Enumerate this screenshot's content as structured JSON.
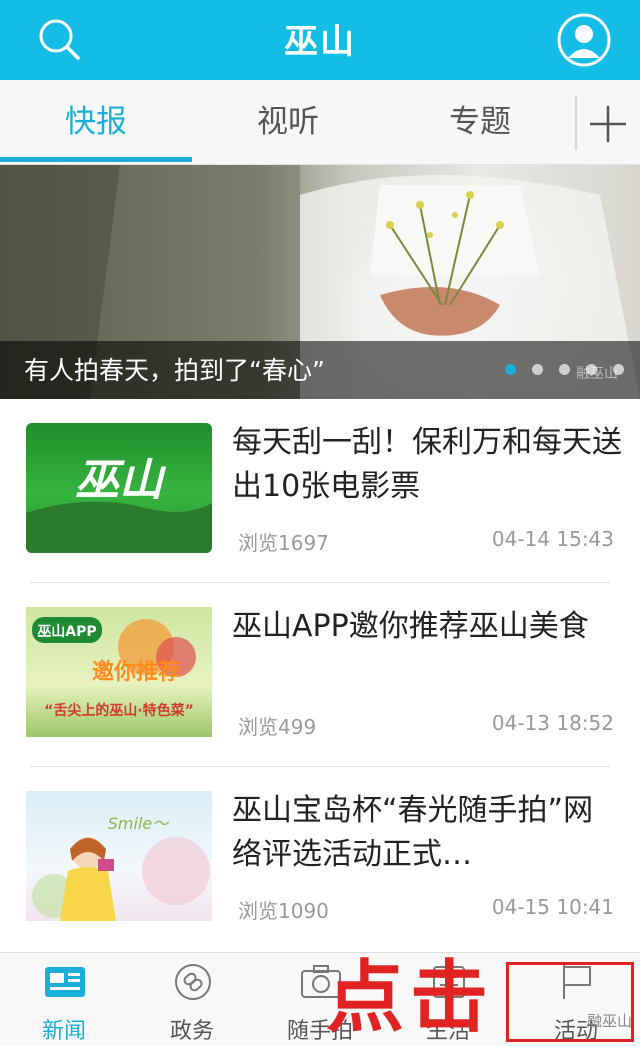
{
  "header": {
    "title": "巫山",
    "search_icon": "search-icon",
    "user_icon": "user-avatar-icon"
  },
  "tabs": [
    {
      "label": "快报",
      "active": true
    },
    {
      "label": "视听",
      "active": false
    },
    {
      "label": "专题",
      "active": false
    }
  ],
  "banner": {
    "caption": "有人拍春天，拍到了“春心”",
    "watermark": "融巫山",
    "dots": 5,
    "active_dot": 1
  },
  "news": [
    {
      "headline": "每天刮一刮！保利万和每天送出10张电影票",
      "views": "浏览1697",
      "time": "04-14 15:43",
      "thumb_text": "巫山"
    },
    {
      "headline": "巫山APP邀你推荐巫山美食",
      "views": "浏览499",
      "time": "04-13 18:52",
      "thumb_text": "巫山APP",
      "thumb_text2": "邀你推荐",
      "thumb_text3": "“舌尖上的巫山·特色菜”"
    },
    {
      "headline": "巫山宝岛杯“春光随手拍”网络评选活动正式…",
      "views": "浏览1090",
      "time": "04-15 10:41",
      "thumb_text": "Smile～"
    }
  ],
  "bottom_nav": [
    {
      "label": "新闻",
      "icon": "newspaper-icon",
      "active": true
    },
    {
      "label": "政务",
      "icon": "link-icon",
      "active": false
    },
    {
      "label": "随手拍",
      "icon": "camera-icon",
      "active": false
    },
    {
      "label": "生活",
      "icon": "life-icon",
      "active": false
    },
    {
      "label": "活动",
      "icon": "flag-icon",
      "active": false
    }
  ],
  "annotation": {
    "text": "点击"
  },
  "watermark": "融巫山",
  "colors": {
    "primary": "#13bde6",
    "accent": "#1aafd8",
    "annotation": "#e02222"
  }
}
